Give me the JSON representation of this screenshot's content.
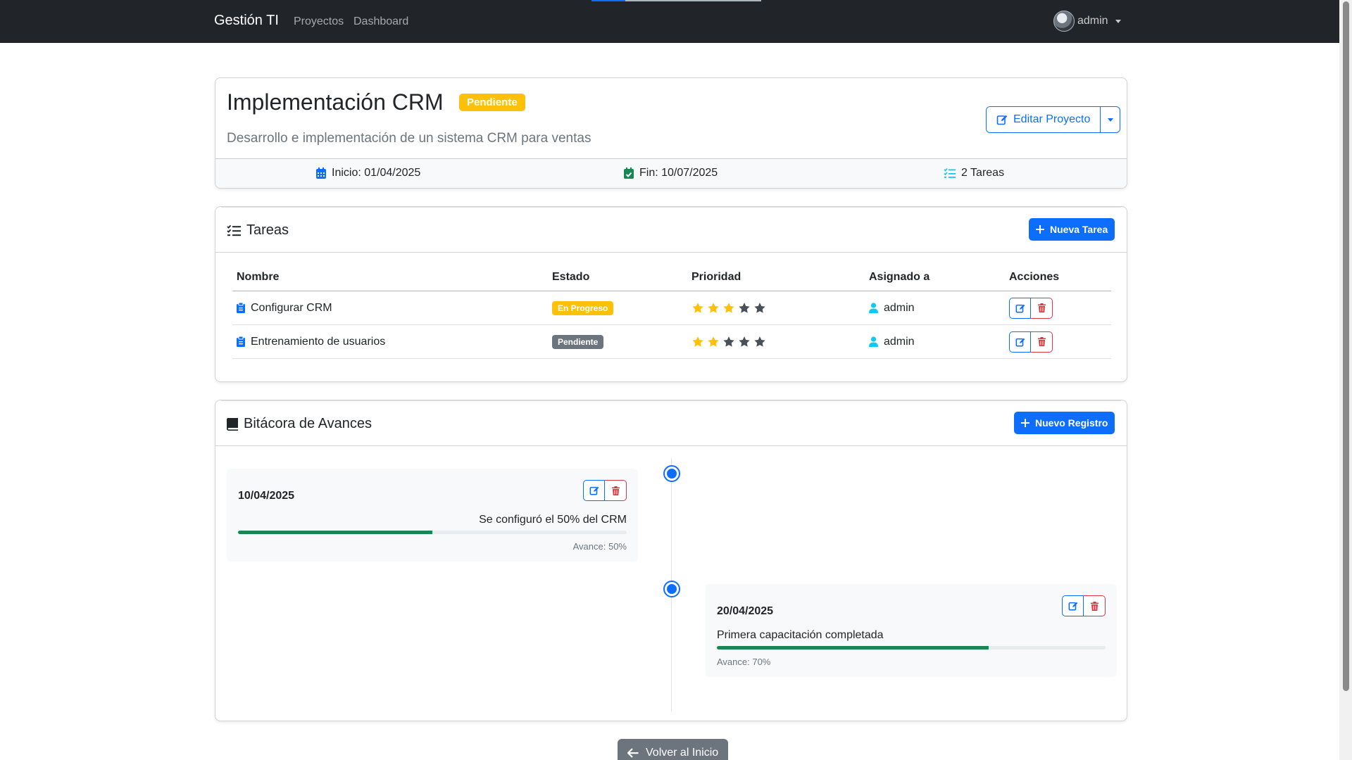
{
  "navbar": {
    "brand": "Gestión TI",
    "links": [
      "Proyectos",
      "Dashboard"
    ],
    "user": "admin"
  },
  "project": {
    "title": "Implementación CRM",
    "status": "Pendiente",
    "description": "Desarrollo e implementación de un sistema CRM para ventas",
    "edit_label": "Editar Proyecto",
    "start": "Inicio: 01/04/2025",
    "end": "Fin: 10/07/2025",
    "task_count": "2 Tareas"
  },
  "tasks": {
    "title": "Tareas",
    "new_button": "Nueva Tarea",
    "columns": [
      "Nombre",
      "Estado",
      "Prioridad",
      "Asignado a",
      "Acciones"
    ],
    "rows": [
      {
        "name": "Configurar CRM",
        "status": "En Progreso",
        "status_color": "#ffc107",
        "priority": 3,
        "assignee": "admin"
      },
      {
        "name": "Entrenamiento de usuarios",
        "status": "Pendiente",
        "status_color": "#6c757d",
        "priority": 2,
        "assignee": "admin"
      }
    ]
  },
  "log": {
    "title": "Bitácora de Avances",
    "new_button": "Nuevo Registro",
    "entries": [
      {
        "date": "10/04/2025",
        "text": "Se configuró el 50% del CRM",
        "progress": 50,
        "progress_label": "Avance: 50%"
      },
      {
        "date": "20/04/2025",
        "text": "Primera capacitación completada",
        "progress": 70,
        "progress_label": "Avance: 70%"
      }
    ]
  },
  "back_button": "Volver al Inicio",
  "colors": {
    "primary": "#0d6efd",
    "danger": "#dc3545",
    "warning": "#ffc107",
    "success": "#198754",
    "secondary": "#6c757d",
    "info": "#0dcaf0",
    "star_on": "#ffc107",
    "star_off": "#495057"
  }
}
